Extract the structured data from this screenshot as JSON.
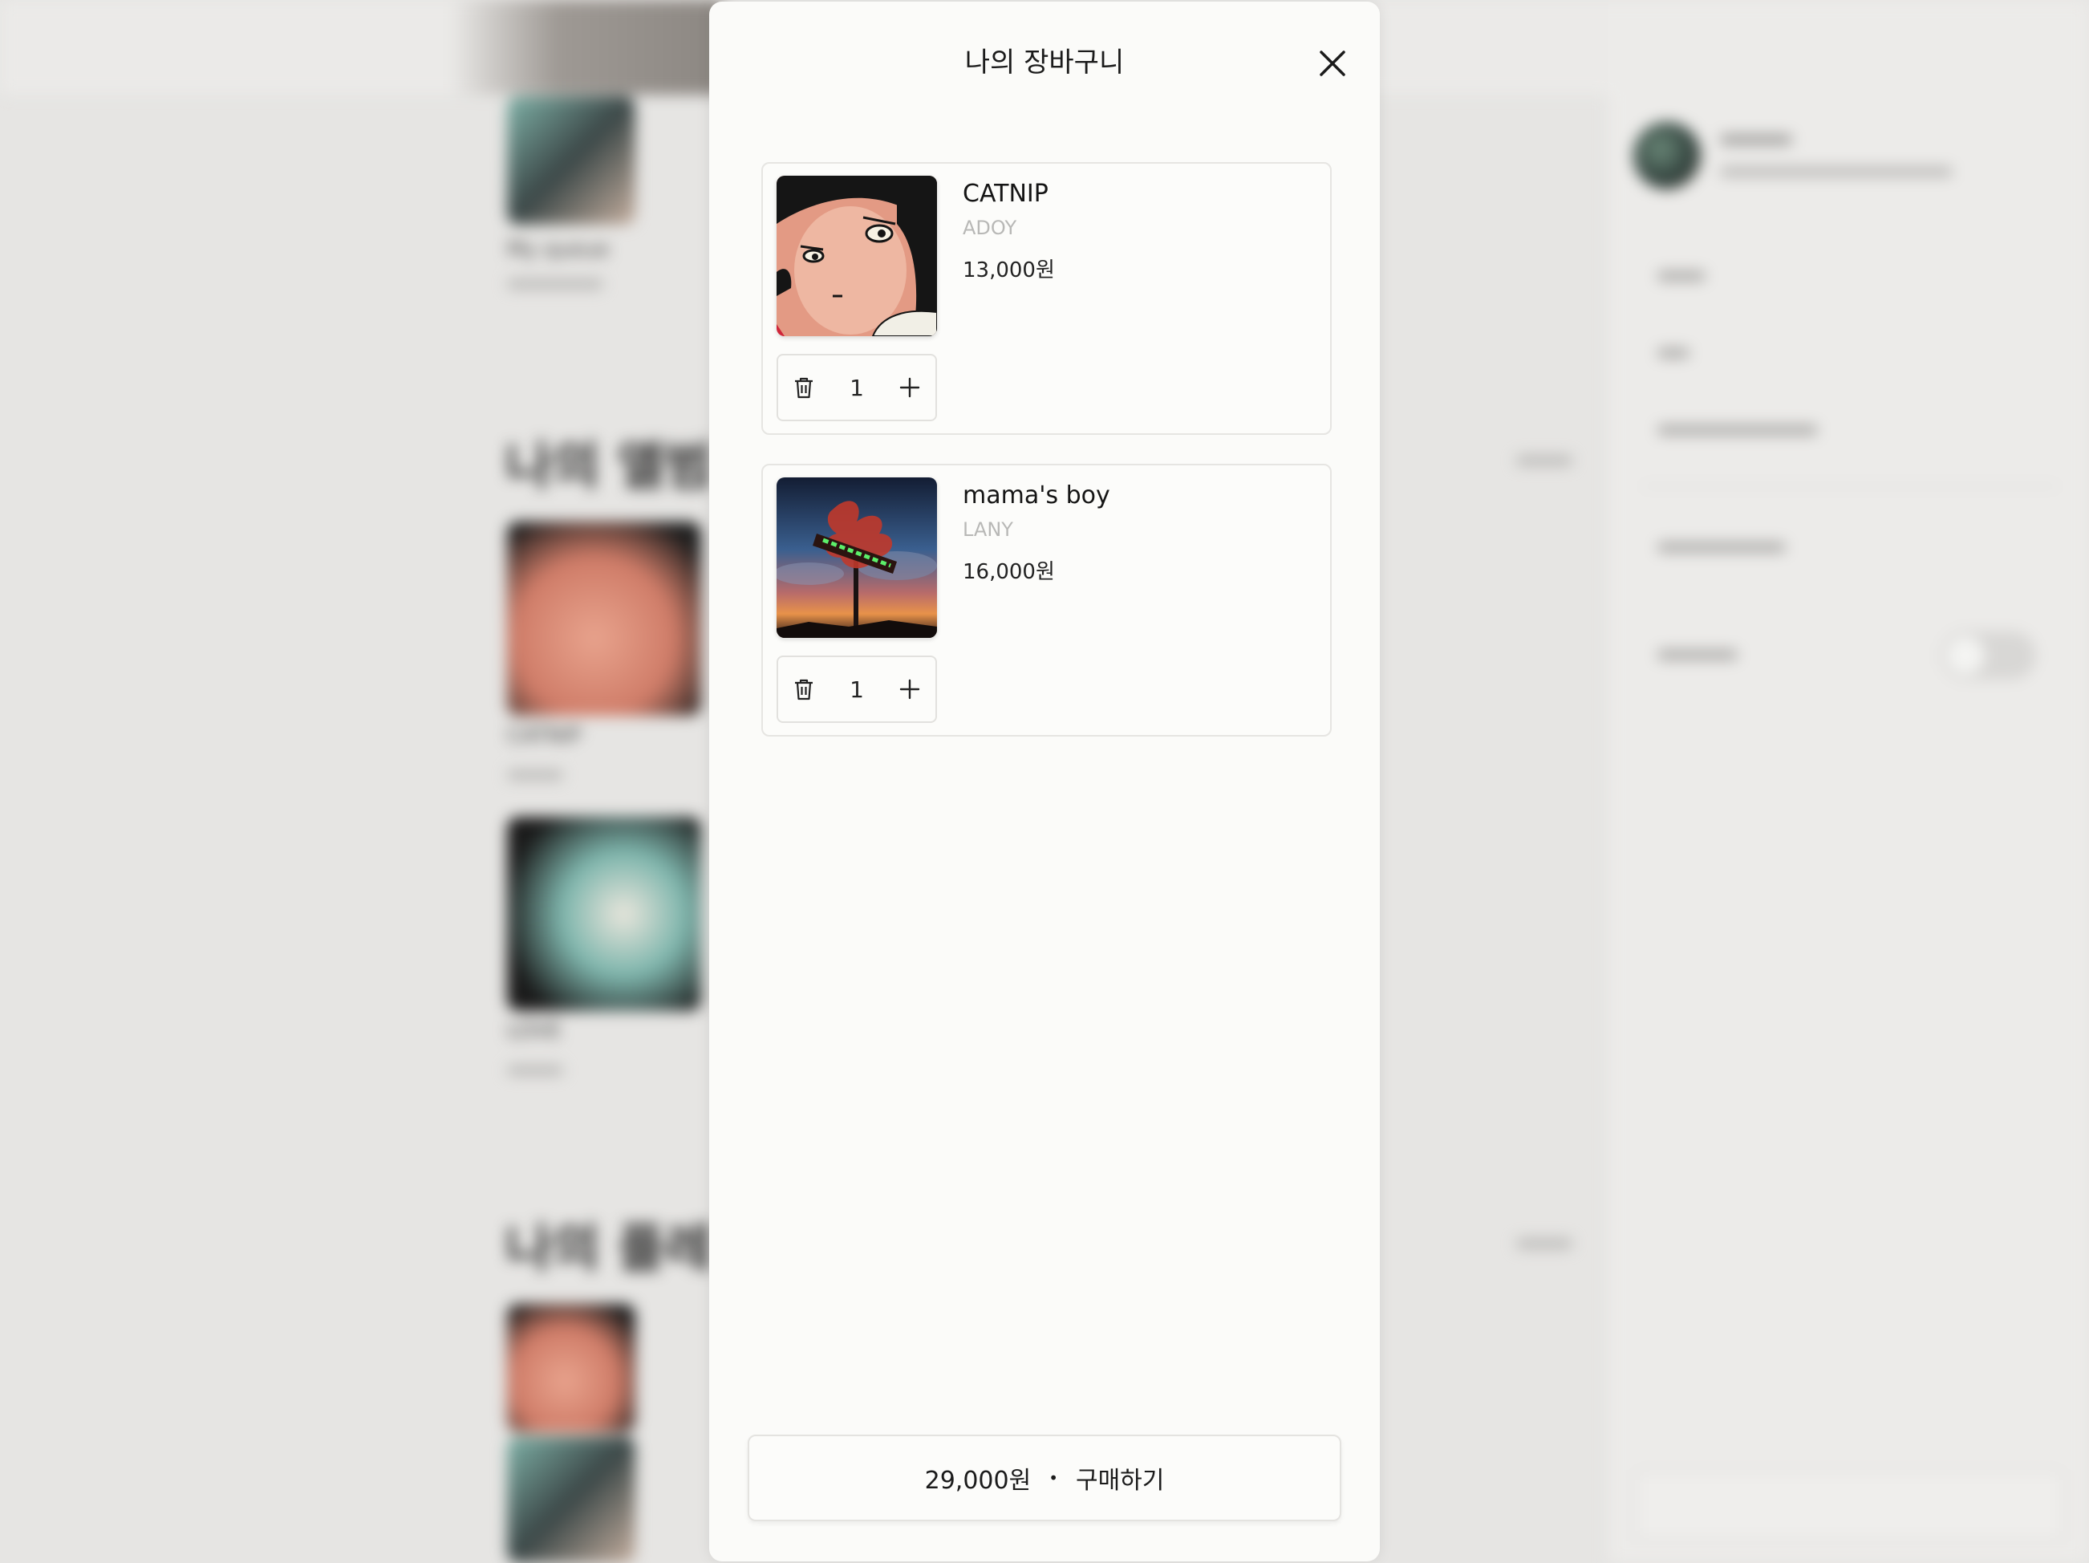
{
  "modal": {
    "title": "나의 장바구니"
  },
  "cart": {
    "items": [
      {
        "title": "CATNIP",
        "artist": "ADOY",
        "price": "13,000원",
        "quantity": "1"
      },
      {
        "title": "mama's boy",
        "artist": "LANY",
        "price": "16,000원",
        "quantity": "1"
      }
    ]
  },
  "checkout": {
    "total": "29,000원",
    "separator": "•",
    "action_label": "구매하기"
  },
  "background": {
    "albums_heading": "나의 앨범",
    "playlists_heading": "나의 플레",
    "queue_caption": "My queue",
    "album_1_caption": "CATNIP",
    "album_2_caption": "LOVE"
  },
  "icons": {
    "close": "close-icon",
    "delete": "trash-icon",
    "increase": "plus-icon"
  }
}
